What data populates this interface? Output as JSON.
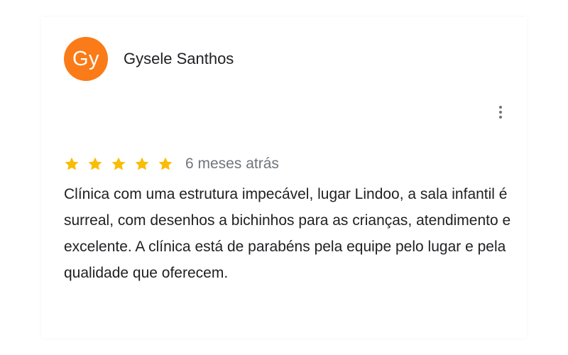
{
  "review": {
    "author": {
      "name": "Gysele Santhos",
      "initials": "Gy",
      "avatar_color": "#fa7b17"
    },
    "rating": 5,
    "max_rating": 5,
    "star_color": "#fbbc04",
    "time_ago": "6 meses atrás",
    "text": "Clínica com uma estrutura impecável, lugar Lindoo, a sala infantil é surreal, com desenhos a bichinhos para as crianças, atendimento e excelente. A clínica está de parabéns pela equipe pelo lugar e pela qualidade que oferecem.",
    "more_icon": "more-vert-icon"
  }
}
